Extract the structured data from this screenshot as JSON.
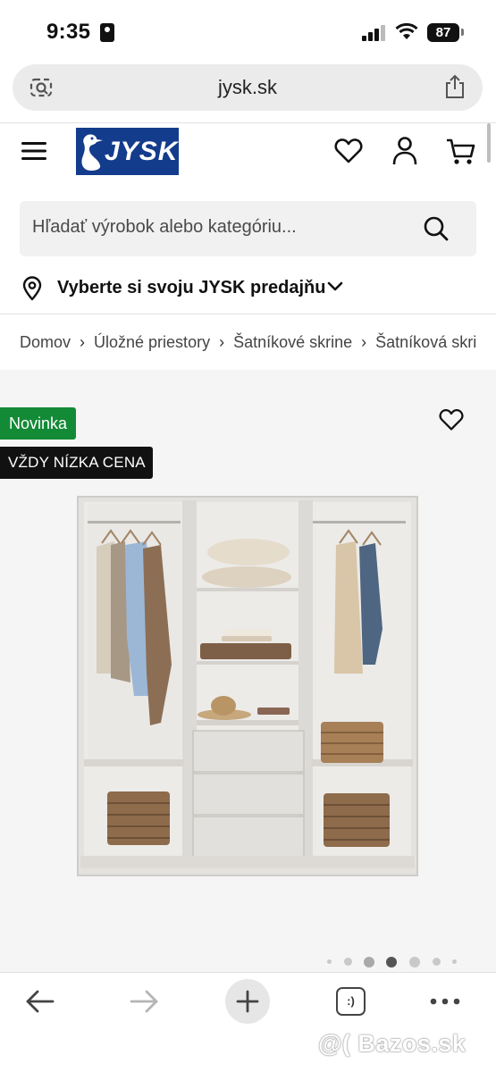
{
  "status_bar": {
    "time": "9:35",
    "battery": "87"
  },
  "browser": {
    "url": "jysk.sk"
  },
  "header": {
    "logo_text": "JYSK",
    "brand_color": "#143c8c"
  },
  "search": {
    "placeholder": "Hľadať výrobok alebo kategóriu..."
  },
  "store_selector": {
    "label": "Vyberte si svoju JYSK predajňu"
  },
  "breadcrumb": {
    "items": [
      "Domov",
      "Úložné priestory",
      "Šatníkové skrine",
      "Šatníková skrin"
    ]
  },
  "product": {
    "badge_new": "Novinka",
    "badge_price": "VŽDY NÍZKA CENA",
    "badge_new_color": "#138a36",
    "image_description_icon": "wardrobe-image",
    "carousel": {
      "count": 7,
      "active_index": 3
    }
  },
  "toolbar": {
    "tabs_label": ":)"
  },
  "watermark": {
    "text": "@( Bazos.sk"
  }
}
